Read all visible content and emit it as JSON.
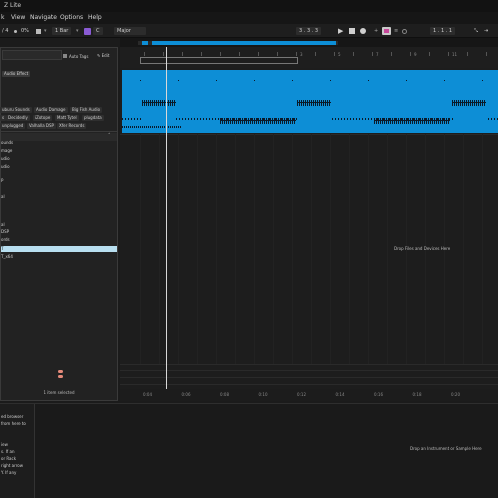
{
  "app": {
    "title": "Z Lite"
  },
  "menu": [
    {
      "label": "k"
    },
    {
      "label": "View"
    },
    {
      "label": "Navigate"
    },
    {
      "label": "Options"
    },
    {
      "label": "Help"
    }
  ],
  "transport": {
    "time_sig": "/ 4",
    "zoom": "0%",
    "quantize": "1 Bar",
    "key": "C",
    "scale": "Major",
    "position": "3 .   3 .   3",
    "loop_end": "1 .   1 .   1"
  },
  "ruler": {
    "bars": [
      "3",
      "5",
      "7",
      "9",
      "11"
    ],
    "times": [
      "0:04",
      "0:06",
      "0:08",
      "0:10",
      "0:12",
      "0:14",
      "0:16",
      "0:18",
      "0:20"
    ]
  },
  "browser": {
    "auto_tags": "Auto Tags",
    "edit": "Edit",
    "active_tag": "Audio Effect",
    "tag_rows": [
      [
        "uburu Sounds",
        "Audio Damage",
        "Big Fish Audio"
      ],
      [
        "s",
        "Decidedly",
        "iZotope",
        "Matt Tytel",
        "plugdata"
      ],
      [
        "unplugged",
        "Valhalla DSP",
        "Xfer Records"
      ]
    ],
    "items": [
      "ounds",
      "mage",
      "udio",
      "udio",
      "P",
      "",
      "al",
      "",
      "",
      "",
      "al",
      "DSP",
      "ords",
      "T",
      "T_x64"
    ],
    "status": "1 item selected"
  },
  "arrangement": {
    "drop_hint": "Drop Files and Devices Here"
  },
  "detail": {
    "help_lines": [
      "ed browser",
      "from here to",
      "",
      "",
      "iew",
      "s. If an",
      "or Rack",
      "right arrow",
      "Y. If any"
    ],
    "drop_hint": "Drop an Instrument or Sample Here"
  },
  "colors": {
    "clip": "#0d8ed6",
    "selection": "#b8dff0",
    "accent": "#8a5bd4"
  }
}
